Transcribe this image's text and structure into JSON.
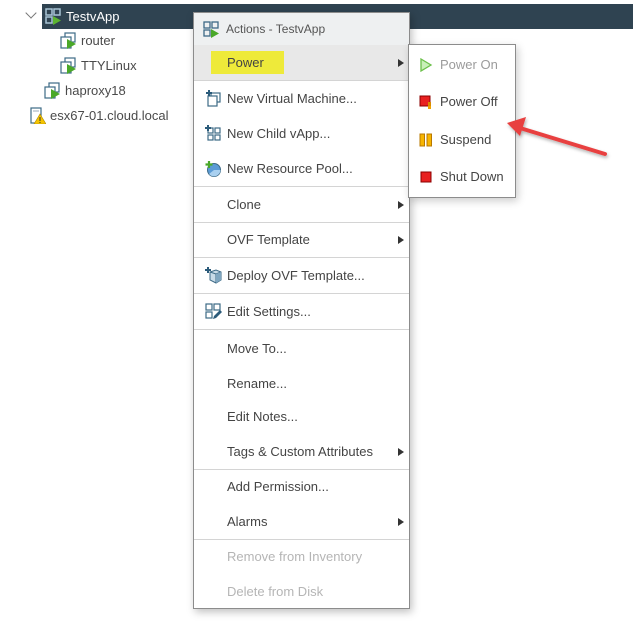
{
  "tree": {
    "items": [
      {
        "label": "TestvApp",
        "icon": "vapp-icon",
        "selected": true,
        "expanded": true
      },
      {
        "label": "router",
        "icon": "vm-powered-on-icon"
      },
      {
        "label": "TTYLinux",
        "icon": "vm-powered-on-icon"
      },
      {
        "label": "haproxy18",
        "icon": "vm-powered-on-icon"
      },
      {
        "label": "esx67-01.cloud.local",
        "icon": "host-warning-icon"
      }
    ]
  },
  "menu": {
    "title": "Actions - TestvApp",
    "items": [
      {
        "label": "Power",
        "submenu": true,
        "highlighted": true
      },
      {
        "label": "New Virtual Machine...",
        "icon": "new-vm-icon"
      },
      {
        "label": "New Child vApp...",
        "icon": "new-vapp-icon"
      },
      {
        "label": "New Resource Pool...",
        "icon": "new-resource-pool-icon"
      },
      {
        "label": "Clone",
        "submenu": true
      },
      {
        "label": "OVF Template",
        "submenu": true
      },
      {
        "label": "Deploy OVF Template...",
        "icon": "deploy-ovf-icon"
      },
      {
        "label": "Edit Settings...",
        "icon": "edit-settings-icon"
      },
      {
        "label": "Move To..."
      },
      {
        "label": "Rename..."
      },
      {
        "label": "Edit Notes..."
      },
      {
        "label": "Tags & Custom Attributes",
        "submenu": true
      },
      {
        "label": "Add Permission..."
      },
      {
        "label": "Alarms",
        "submenu": true
      },
      {
        "label": "Remove from Inventory",
        "disabled": true
      },
      {
        "label": "Delete from Disk",
        "disabled": true
      }
    ]
  },
  "power_submenu": {
    "items": [
      {
        "label": "Power On",
        "icon": "power-on-icon",
        "disabled": true
      },
      {
        "label": "Power Off",
        "icon": "power-off-icon"
      },
      {
        "label": "Suspend",
        "icon": "suspend-icon"
      },
      {
        "label": "Shut Down",
        "icon": "shut-down-icon"
      }
    ]
  },
  "colors": {
    "selection_bg": "#2f4351",
    "highlight": "#eeea3a",
    "annotation_arrow": "#e8403f"
  }
}
